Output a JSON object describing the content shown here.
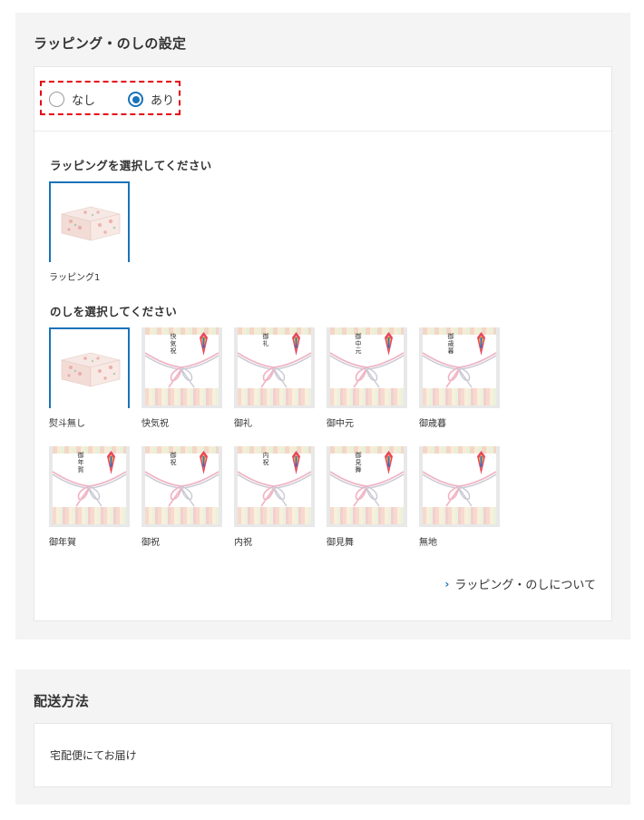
{
  "wrapping_section": {
    "title": "ラッピング・のしの設定",
    "radio_options": [
      {
        "label": "なし",
        "selected": false
      },
      {
        "label": "あり",
        "selected": true
      }
    ],
    "wrap_prompt": "ラッピングを選択してください",
    "wraps": [
      {
        "caption": "ラッピング1",
        "selected": true
      }
    ],
    "noshi_prompt": "のしを選択してください",
    "noshi_options": [
      {
        "caption": "熨斗無し",
        "label": "",
        "selected": true,
        "type": "box"
      },
      {
        "caption": "快気祝",
        "label": "快気祝",
        "selected": false,
        "type": "noshi"
      },
      {
        "caption": "御礼",
        "label": "御礼",
        "selected": false,
        "type": "noshi"
      },
      {
        "caption": "御中元",
        "label": "御中元",
        "selected": false,
        "type": "noshi"
      },
      {
        "caption": "御歳暮",
        "label": "御歳暮",
        "selected": false,
        "type": "noshi"
      },
      {
        "caption": "御年賀",
        "label": "御年賀",
        "selected": false,
        "type": "noshi"
      },
      {
        "caption": "御祝",
        "label": "御祝",
        "selected": false,
        "type": "noshi"
      },
      {
        "caption": "内祝",
        "label": "内祝",
        "selected": false,
        "type": "noshi"
      },
      {
        "caption": "御見舞",
        "label": "御見舞",
        "selected": false,
        "type": "noshi"
      },
      {
        "caption": "無地",
        "label": "",
        "selected": false,
        "type": "noshi"
      }
    ],
    "info_link": "ラッピング・のしについて"
  },
  "delivery_section": {
    "title": "配送方法",
    "method": "宅配便にてお届け"
  },
  "colors": {
    "accent": "#1a73b8",
    "highlight": "#e60012",
    "section_bg": "#f4f4f4"
  }
}
